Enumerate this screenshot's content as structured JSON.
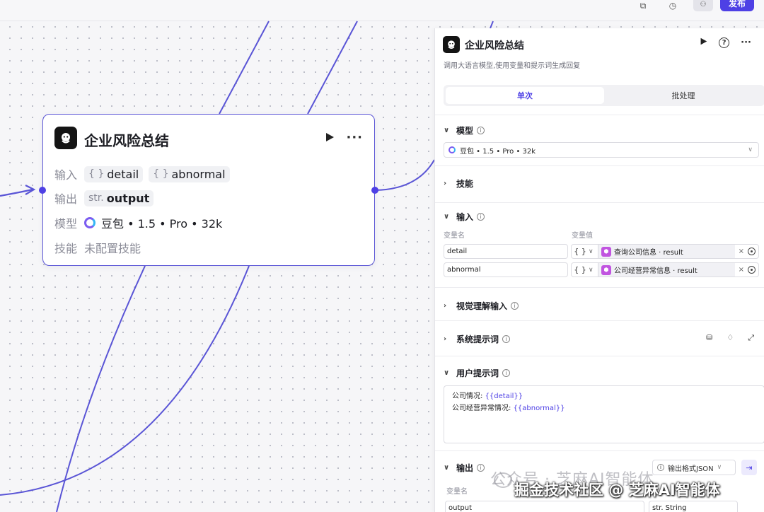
{
  "topbar": {
    "publish_label": "发布"
  },
  "node": {
    "title": "企业风险总结",
    "input_label": "输入",
    "inputs": [
      {
        "type": "{ }",
        "name": "detail"
      },
      {
        "type": "{ }",
        "name": "abnormal"
      }
    ],
    "output_label": "输出",
    "output": {
      "type": "str.",
      "name": "output"
    },
    "model_label": "模型",
    "model_value": "豆包 • 1.5 • Pro • 32k",
    "skill_label": "技能",
    "skill_value": "未配置技能"
  },
  "panel": {
    "title": "企业风险总结",
    "description": "调用大语言模型,使用变量和提示词生成回复",
    "tabs": [
      {
        "label": "单次",
        "active": true
      },
      {
        "label": "批处理",
        "active": false
      }
    ],
    "model_section": "模型",
    "model_select": "豆包 • 1.5 • Pro • 32k",
    "skill_section": "技能",
    "input_section": "输入",
    "var_name_header": "变量名",
    "var_value_header": "变量值",
    "input_rows": [
      {
        "name": "detail",
        "type": "{ }",
        "ref": "查询公司信息 · result"
      },
      {
        "name": "abnormal",
        "type": "{ }",
        "ref": "公司经营异常信息 · result"
      }
    ],
    "vision_section": "视觉理解输入",
    "system_prompt_section": "系统提示词",
    "user_prompt_section": "用户提示词",
    "user_prompt_lines": [
      {
        "text": "公司情况: ",
        "var": "{{detail}}"
      },
      {
        "text": "公司经营异常情况: ",
        "var": "{{abnormal}}"
      }
    ],
    "output_section": "输出",
    "output_format": "输出格式JSON",
    "output_var_header": "变量名",
    "output_var_name": "output",
    "output_var_type": "str. String"
  },
  "watermark": {
    "line1": "公众号 · 芝麻AI智能体",
    "line2": "掘金技术社区 @ 芝麻AI智能体"
  },
  "colors": {
    "accent": "#4e40e5",
    "wire": "#5a55d6"
  }
}
